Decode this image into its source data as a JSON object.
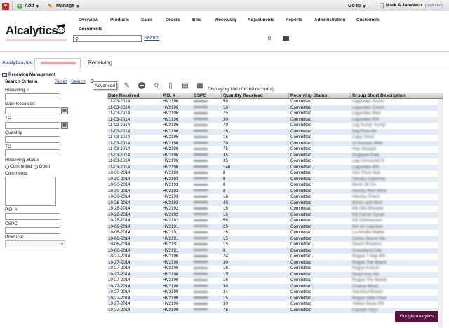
{
  "topbar": {
    "add_label": "Add",
    "manage_label": "Manage",
    "goto_label": "Go to",
    "user_name": "Mark A Janveaux",
    "signout_label": "(Sign Out)"
  },
  "header": {
    "logo_text": "Alcalytics",
    "nav": [
      "Overview",
      "Products",
      "Sales",
      "Orders",
      "Bills",
      "Receiving",
      "Adjustments",
      "Reports",
      "Administration",
      "Customers"
    ],
    "active_nav": "Receiving",
    "documents_label": "Documents",
    "search_link": "Search",
    "notification_count": "0"
  },
  "breadcrumb": {
    "company": "Alcalytics, Inc",
    "current": "Receiving"
  },
  "left_panel": {
    "title": "Receiving Management",
    "criteria_label": "Search Criteria",
    "reset_label": "Reset",
    "search_label": "Search",
    "fields": {
      "receiving_no": "Receiving #",
      "date_received": "Date Received",
      "to1": "TO",
      "quantity": "Quantity",
      "to2": "TO",
      "receiving_status": "Receiving Status",
      "committed": "Committed",
      "open": "Open",
      "comments": "Comments",
      "po": "P.O. #",
      "cspc": "CSPC",
      "producer": "Producer"
    }
  },
  "toolbar": {
    "advanced_tooltip": "Advanced",
    "display_text": "Displaying 100 of 6160 record(s)"
  },
  "grid": {
    "columns": [
      "Date Received",
      "P.O. #",
      "CSPC",
      "Quantity Received",
      "Receiving Status",
      "Group Short Description"
    ],
    "rows": [
      [
        "11-03-2014",
        "HV2196",
        "50",
        "Committed",
        "Lagunitas Sucks"
      ],
      [
        "11-03-2014",
        "HV2196",
        "16",
        "Committed",
        "Lagunitas Czech"
      ],
      [
        "11-03-2014",
        "HV2196",
        "75",
        "Committed",
        "Lagunitas Red"
      ],
      [
        "11-03-2014",
        "HV2196",
        "30",
        "Committed",
        "Lagunitas IPA"
      ],
      [
        "11-03-2014",
        "HV2196",
        "70",
        "Committed",
        "Lag Sump' Sump'"
      ],
      [
        "11-03-2014",
        "HV2196",
        "16",
        "Committed",
        "DayTime Ale"
      ],
      [
        "11-03-2014",
        "HV2196",
        "15",
        "Committed",
        "Capp Stout"
      ],
      [
        "11-03-2014",
        "HV2196",
        "70",
        "Committed",
        "Lil Sumpin Wild"
      ],
      [
        "11-03-2014",
        "HV2196",
        "75",
        "Committed",
        "Hop Stoopid"
      ],
      [
        "11-03-2014",
        "HV2196",
        "35",
        "Committed",
        "Dogtown Pale"
      ],
      [
        "11-03-2014",
        "HV2196",
        "35",
        "Committed",
        "Lag Censored Al"
      ],
      [
        "11-03-2014",
        "HV2196",
        "140",
        "Committed",
        "Lagunitas IPA"
      ],
      [
        "10-30-2014",
        "HV2193",
        "8",
        "Committed",
        "Hen Pinot Noir"
      ],
      [
        "10-30-2014",
        "HV2193",
        "8",
        "Committed",
        "Handry Cabernet"
      ],
      [
        "10-30-2014",
        "HV2193",
        "8",
        "Committed",
        "Block 28 Zin"
      ],
      [
        "10-30-2014",
        "HV2193",
        "8",
        "Committed",
        "Handry Red Wine"
      ],
      [
        "10-30-2014",
        "HV2193",
        "16",
        "Committed",
        "Handry Chard"
      ],
      [
        "10-28-2014",
        "HV2192",
        "40",
        "Committed",
        "Bricks and Mort"
      ],
      [
        "10-28-2014",
        "HV2192",
        "16",
        "Committed",
        "KB Old Ghoston"
      ],
      [
        "10-28-2014",
        "HV2192",
        "16",
        "Committed",
        "KB Farrah Syrah"
      ],
      [
        "10-28-2014",
        "HV2192",
        "56",
        "Committed",
        "KB Oldvineuum"
      ],
      [
        "10-06-2014",
        "HV2191",
        "25",
        "Committed",
        "Bel Air Lagnave"
      ],
      [
        "10-06-2014",
        "HV2191",
        "16",
        "Committed",
        "La Amalia Malbe"
      ],
      [
        "10-06-2014",
        "HV2191",
        "15",
        "Committed",
        "Carlos Basso Ma"
      ],
      [
        "10-06-2014",
        "HV2191",
        "15",
        "Committed",
        "Sasch Proseco"
      ],
      [
        "10-06-2014",
        "HV2191",
        "8",
        "Committed",
        "Graceland Cab"
      ],
      [
        "10-27-2014",
        "HV2190",
        "24",
        "Committed",
        "Rogue 7 Hop IPA"
      ],
      [
        "10-27-2014",
        "HV2190",
        "30",
        "Committed",
        "Rogue The Beard"
      ],
      [
        "10-27-2014",
        "HV2190",
        "16",
        "Committed",
        "Rogue Kolsch"
      ],
      [
        "10-27-2014",
        "HV2190",
        "15",
        "Committed",
        "Dead Guy Ale"
      ],
      [
        "10-27-2014",
        "HV2190",
        "16",
        "Committed",
        "Rogue The Beard"
      ],
      [
        "10-27-2014",
        "HV2190",
        "30",
        "Committed",
        "Chatoe Mead"
      ],
      [
        "10-27-2014",
        "HV2190",
        "24",
        "Committed",
        "Hazelnut Brown"
      ],
      [
        "10-27-2014",
        "HV2190",
        "15",
        "Committed",
        "Rogue Olde Choc"
      ],
      [
        "10-27-2014",
        "HV2190",
        "30",
        "Committed",
        "Yellow Snow IPA"
      ],
      [
        "10-27-2014",
        "HV2190",
        "75",
        "Committed",
        "Captain Sig's"
      ]
    ]
  },
  "analytics_badge": "Google Analytics"
}
